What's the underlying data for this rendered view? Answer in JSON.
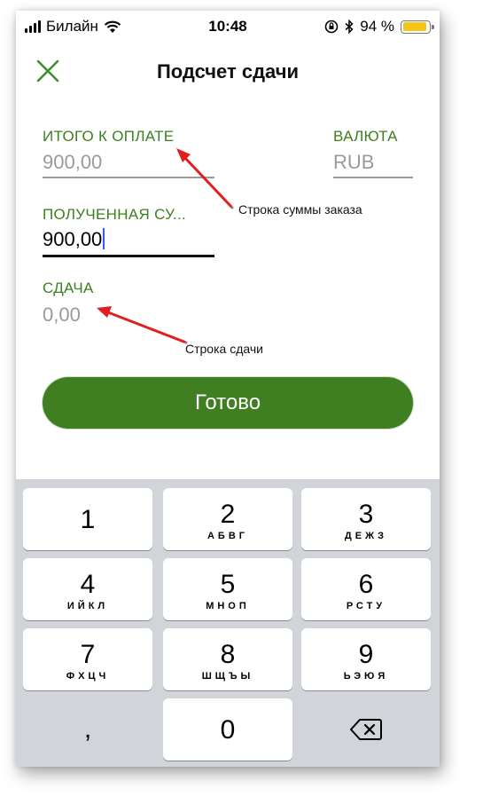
{
  "status": {
    "carrier": "Билайн",
    "time": "10:48",
    "battery": "94 %"
  },
  "header": {
    "title": "Подсчет сдачи",
    "close_icon": "close-x-icon"
  },
  "form": {
    "total": {
      "label": "ИТОГО К ОПЛАТЕ",
      "value": "900,00"
    },
    "currency": {
      "label": "ВАЛЮТА",
      "value": "RUB"
    },
    "received": {
      "label": "ПОЛУЧЕННАЯ СУ...",
      "value": "900,00"
    },
    "change": {
      "label": "СДАЧА",
      "value": "0,00"
    }
  },
  "done_label": "Готово",
  "annotations": {
    "order_sum": "Строка суммы заказа",
    "change": "Строка сдачи"
  },
  "keyboard": {
    "k1": {
      "digit": "1",
      "letters": ""
    },
    "k2": {
      "digit": "2",
      "letters": "АБВГ"
    },
    "k3": {
      "digit": "3",
      "letters": "ДЕЖЗ"
    },
    "k4": {
      "digit": "4",
      "letters": "ИЙКЛ"
    },
    "k5": {
      "digit": "5",
      "letters": "МНОП"
    },
    "k6": {
      "digit": "6",
      "letters": "РСТУ"
    },
    "k7": {
      "digit": "7",
      "letters": "ФХЦЧ"
    },
    "k8": {
      "digit": "8",
      "letters": "ШЩЪЫ"
    },
    "k9": {
      "digit": "9",
      "letters": "ЬЭЮЯ"
    },
    "comma": ",",
    "k0": {
      "digit": "0"
    }
  },
  "colors": {
    "accent": "#3f7f22",
    "label": "#3c7f1f",
    "cursor": "#2f5bff",
    "arrow": "#e02020"
  }
}
